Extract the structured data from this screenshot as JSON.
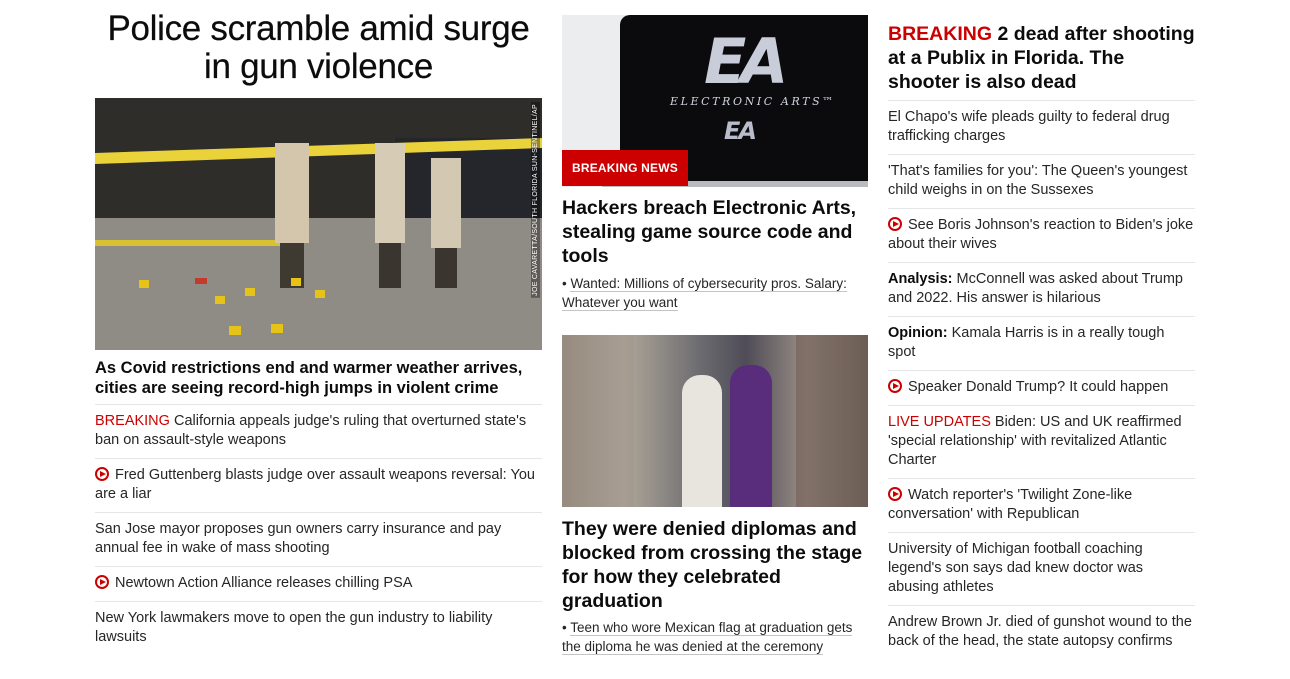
{
  "left_column": {
    "headline": "Police scramble amid surge in gun violence",
    "photo_credit": "JOE CAVARETTA/SOUTH FLORIDA SUN-SENTINEL/AP",
    "subheadline": "As Covid restrictions end and warmer weather arrives, cities are seeing record-high jumps in violent crime",
    "items": [
      {
        "prefix": "BREAKING",
        "text": "California appeals judge's ruling that overturned state's ban on assault-style weapons"
      },
      {
        "video": true,
        "text": "Fred Guttenberg blasts judge over assault weapons reversal: You are a liar"
      },
      {
        "text": "San Jose mayor proposes gun owners carry insurance and pay annual fee in wake of mass shooting"
      },
      {
        "video": true,
        "text": "Newtown Action Alliance releases chilling PSA"
      },
      {
        "text": "New York lawmakers move to open the gun industry to liability lawsuits"
      }
    ]
  },
  "middle_column": {
    "story1": {
      "badge": "BREAKING NEWS",
      "image_logo": "EA",
      "image_wordmark": "ELECTRONIC ARTS™",
      "headline": "Hackers breach Electronic Arts, stealing game source code and tools",
      "related": "Wanted: Millions of cybersecurity pros. Salary: Whatever you want"
    },
    "story2": {
      "headline": "They were denied diplomas and blocked from crossing the stage for how they celebrated graduation",
      "related": "Teen who wore Mexican flag at graduation gets the diploma he was denied at the ceremony"
    }
  },
  "right_column": {
    "headline_prefix": "BREAKING",
    "headline": "2 dead after shooting at a Publix in Florida. The shooter is also dead",
    "items": [
      {
        "text": "El Chapo's wife pleads guilty to federal drug trafficking charges"
      },
      {
        "text": "'That's families for you': The Queen's youngest child weighs in on the Sussexes"
      },
      {
        "video": true,
        "text": "See Boris Johnson's reaction to Biden's joke about their wives"
      },
      {
        "label": "Analysis:",
        "text": "McConnell was asked about Trump and 2022. His answer is hilarious"
      },
      {
        "label": "Opinion:",
        "text": "Kamala Harris is in a really tough spot"
      },
      {
        "video": true,
        "text": "Speaker Donald Trump? It could happen"
      },
      {
        "prefix": "LIVE UPDATES",
        "text": "Biden: US and UK reaffirmed 'special relationship' with revitalized Atlantic Charter"
      },
      {
        "video": true,
        "text": "Watch reporter's 'Twilight Zone-like conversation' with Republican"
      },
      {
        "text": "University of Michigan football coaching legend's son says dad knew doctor was abusing athletes"
      },
      {
        "text": "Andrew Brown Jr. died of gunshot wound to the back of the head, the state autopsy confirms"
      }
    ]
  },
  "theme": {
    "accent_red": "#cc0000",
    "text": "#0c0c0c",
    "divider": "#e6e6e6"
  }
}
